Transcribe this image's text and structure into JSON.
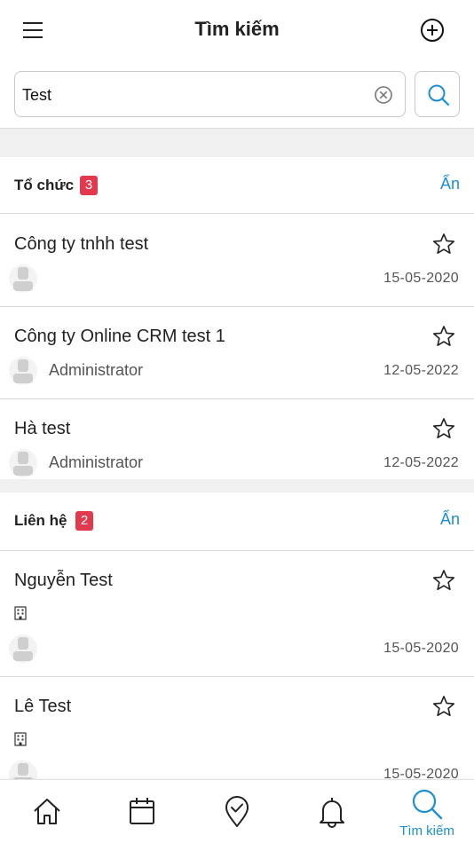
{
  "header": {
    "title": "Tìm kiếm",
    "menu_icon": "hamburger-menu-icon",
    "add_icon": "plus-circle-icon"
  },
  "search": {
    "value": "Test",
    "placeholder": "",
    "clear_icon": "clear-circle-x-icon",
    "search_icon": "magnifier-icon"
  },
  "sections": {
    "organizations": {
      "title": "Tổ chức",
      "count": "3",
      "hide_label": "Ẩn",
      "items": [
        {
          "name": "Công ty tnhh test",
          "owner": "",
          "date": "15-05-2020"
        },
        {
          "name": "Công ty Online CRM test 1",
          "owner": "Administrator",
          "date": "12-05-2022"
        },
        {
          "name": "Hà test",
          "owner": "Administrator",
          "date": "12-05-2022"
        }
      ]
    },
    "contacts": {
      "title": "Liên hệ",
      "count": "2",
      "hide_label": "Ẩn",
      "items": [
        {
          "name": "Nguyễn Test",
          "company_icon": "building-icon",
          "date": "15-05-2020"
        },
        {
          "name": "Lê Test",
          "company_icon": "building-icon",
          "date": "15-05-2020"
        }
      ]
    }
  },
  "tabbar": {
    "tabs": [
      {
        "icon": "home-icon",
        "label": ""
      },
      {
        "icon": "calendar-icon",
        "label": ""
      },
      {
        "icon": "location-check-icon",
        "label": ""
      },
      {
        "icon": "bell-icon",
        "label": ""
      },
      {
        "icon": "search-icon",
        "label": "Tìm kiếm"
      }
    ],
    "active_index": 4
  },
  "colors": {
    "accent": "#1a8fd6",
    "badge": "#e2394e",
    "separator": "#f0f0f0"
  }
}
